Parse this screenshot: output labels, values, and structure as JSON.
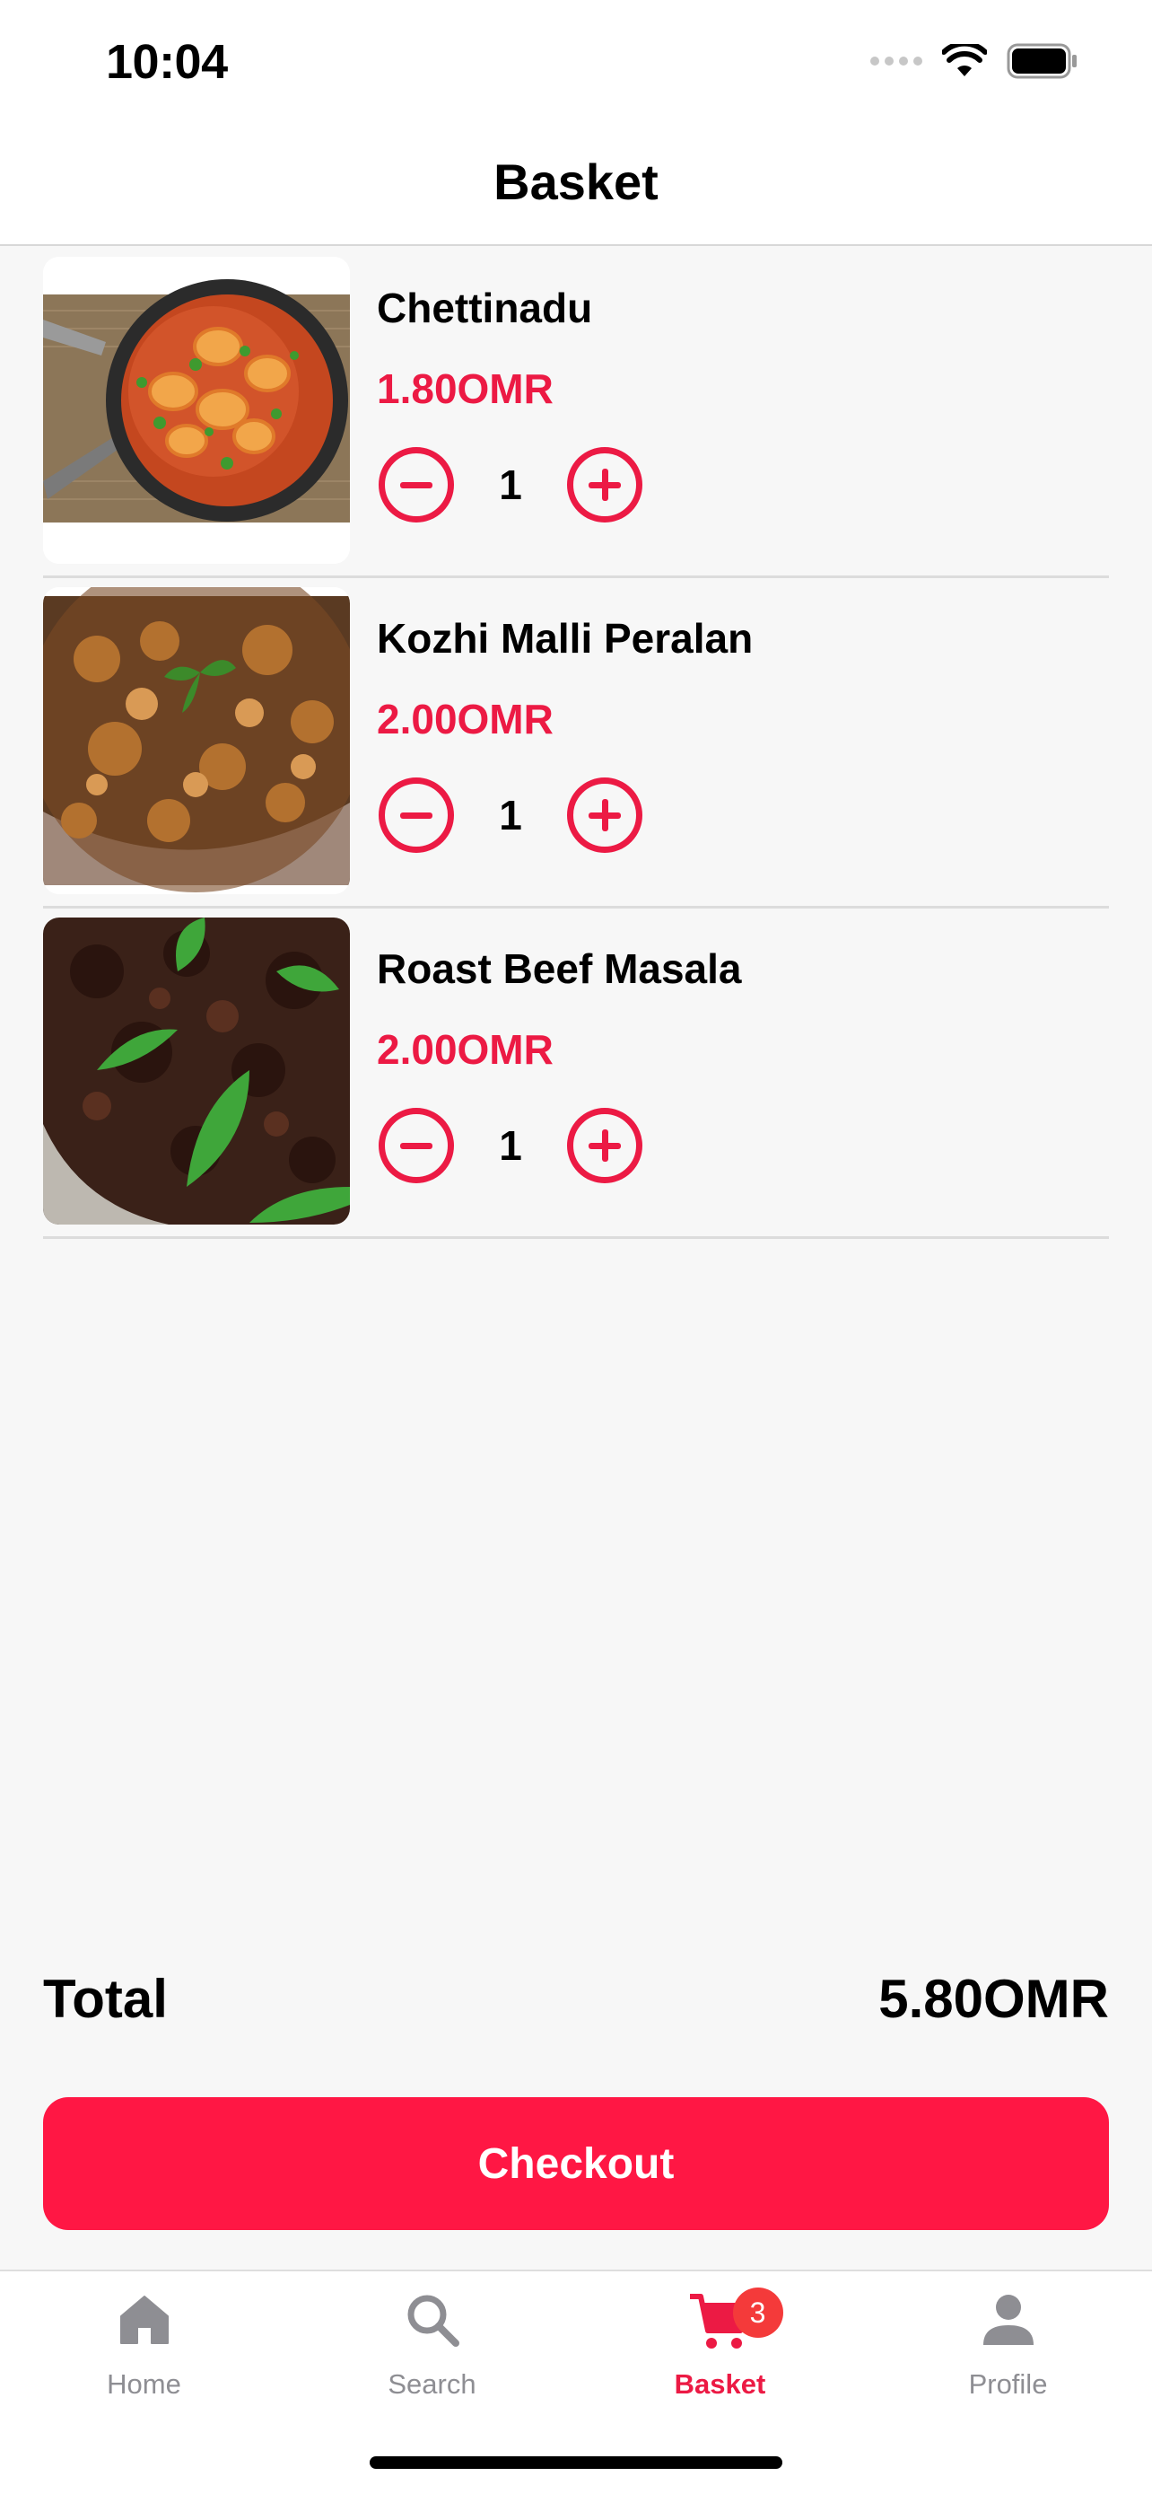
{
  "status_bar": {
    "time": "10:04",
    "icons": [
      "signal-icon",
      "wifi-icon",
      "battery-icon"
    ]
  },
  "header": {
    "title": "Basket"
  },
  "basket": {
    "items": [
      {
        "name": "Chettinadu",
        "price": "1.80OMR",
        "quantity": "1",
        "image": "prawn-curry-dish"
      },
      {
        "name": "Kozhi Malli Peralan",
        "price": "2.00OMR",
        "quantity": "1",
        "image": "chicken-curry-dish"
      },
      {
        "name": "Roast Beef Masala",
        "price": "2.00OMR",
        "quantity": "1",
        "image": "beef-roast-dish"
      }
    ]
  },
  "summary": {
    "total_label": "Total",
    "total_value": "5.80OMR"
  },
  "checkout": {
    "label": "Checkout"
  },
  "tab_bar": {
    "tabs": [
      {
        "label": "Home",
        "icon": "home-icon"
      },
      {
        "label": "Search",
        "icon": "search-icon"
      },
      {
        "label": "Basket",
        "icon": "cart-icon",
        "badge": "3",
        "active": true
      },
      {
        "label": "Profile",
        "icon": "person-icon"
      }
    ]
  },
  "colors": {
    "accent": "#ec1a44",
    "checkout": "#ff1744",
    "badge": "#f43a3a",
    "inactive_tab": "#8e8e93",
    "background": "#f7f7f7"
  }
}
